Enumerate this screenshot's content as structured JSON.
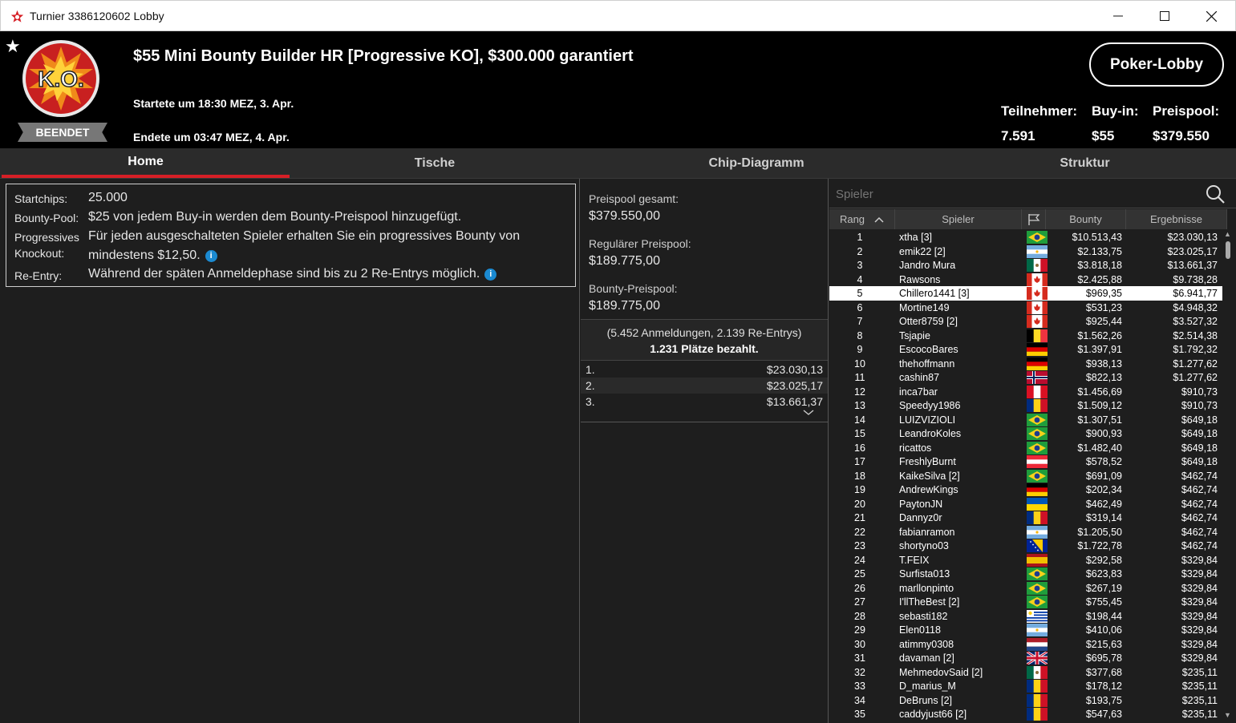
{
  "window": {
    "title": "Turnier 3386120602 Lobby"
  },
  "header": {
    "status": "BEENDET",
    "tournament_name": "$55 Mini Bounty Builder HR [Progressive KO], $300.000 garantiert",
    "started": "Startete um 18:30 MEZ, 3. Apr.",
    "ended": "Endete um 03:47 MEZ, 4. Apr.",
    "lobby_button": "Poker-Lobby",
    "logo_text": "K.O.",
    "stats": {
      "participants_label": "Teilnehmer:",
      "participants": "7.591",
      "buyin_label": "Buy-in:",
      "buyin": "$55",
      "prizepool_label": "Preispool:",
      "prizepool": "$379.550"
    }
  },
  "tabs": [
    "Home",
    "Tische",
    "Chip-Diagramm",
    "Struktur"
  ],
  "info": {
    "startchips_label": "Startchips:",
    "startchips": "25.000",
    "bountypool_label": "Bounty-Pool:",
    "bountypool": "$25 von jedem Buy-in werden dem Bounty-Preispool hinzugefügt.",
    "pko_label_1": "Progressives",
    "pko_label_2": "Knockout:",
    "pko_text_1": "Für jeden ausgeschalteten Spieler erhalten Sie ein progressives Bounty von",
    "pko_text_2": "mindestens $12,50.",
    "reentry_label": "Re-Entry:",
    "reentry": "Während der späten Anmeldephase sind bis zu 2 Re-Entrys möglich."
  },
  "prizepool": {
    "total_label": "Preispool gesamt:",
    "total": "$379.550,00",
    "regular_label": "Regulärer Preispool:",
    "regular": "$189.775,00",
    "bounty_label": "Bounty-Preispool:",
    "bounty": "$189.775,00",
    "registrations": "(5.452 Anmeldungen, 2.139 Re-Entrys)",
    "paid_places": "1.231 Plätze bezahlt.",
    "payouts": [
      {
        "rank": "1.",
        "amount": "$23.030,13"
      },
      {
        "rank": "2.",
        "amount": "$23.025,17"
      },
      {
        "rank": "3.",
        "amount": "$13.661,37"
      }
    ]
  },
  "players": {
    "search_placeholder": "Spieler",
    "columns": {
      "rank": "Rang",
      "player": "Spieler",
      "bounty": "Bounty",
      "result": "Ergebnisse"
    },
    "selected_rank": "5",
    "rows": [
      {
        "rank": "1",
        "name": "xtha [3]",
        "flag": "br",
        "bounty": "$10.513,43",
        "result": "$23.030,13"
      },
      {
        "rank": "2",
        "name": "emik22 [2]",
        "flag": "ar",
        "bounty": "$2.133,75",
        "result": "$23.025,17"
      },
      {
        "rank": "3",
        "name": "Jandro Mura",
        "flag": "mx",
        "bounty": "$3.818,18",
        "result": "$13.661,37"
      },
      {
        "rank": "4",
        "name": "Rawsons",
        "flag": "ca",
        "bounty": "$2.425,88",
        "result": "$9.738,28"
      },
      {
        "rank": "5",
        "name": "Chillero1441 [3]",
        "flag": "ca",
        "bounty": "$969,35",
        "result": "$6.941,77"
      },
      {
        "rank": "6",
        "name": "Mortine149",
        "flag": "ca",
        "bounty": "$531,23",
        "result": "$4.948,32"
      },
      {
        "rank": "7",
        "name": "Otter8759 [2]",
        "flag": "ca",
        "bounty": "$925,44",
        "result": "$3.527,32"
      },
      {
        "rank": "8",
        "name": "Tsjapie",
        "flag": "be",
        "bounty": "$1.562,26",
        "result": "$2.514,38"
      },
      {
        "rank": "9",
        "name": "EscocoBares",
        "flag": "de",
        "bounty": "$1.397,91",
        "result": "$1.792,32"
      },
      {
        "rank": "10",
        "name": "thehoffmann",
        "flag": "de",
        "bounty": "$938,13",
        "result": "$1.277,62"
      },
      {
        "rank": "11",
        "name": "cashin87",
        "flag": "no",
        "bounty": "$822,13",
        "result": "$1.277,62"
      },
      {
        "rank": "12",
        "name": "inca7bar",
        "flag": "pe",
        "bounty": "$1.456,69",
        "result": "$910,73"
      },
      {
        "rank": "13",
        "name": "Speedyy1986",
        "flag": "ro",
        "bounty": "$1.509,12",
        "result": "$910,73"
      },
      {
        "rank": "14",
        "name": "LUIZVIZIOLI",
        "flag": "br",
        "bounty": "$1.307,51",
        "result": "$649,18"
      },
      {
        "rank": "15",
        "name": "LeandroKoles",
        "flag": "br",
        "bounty": "$900,93",
        "result": "$649,18"
      },
      {
        "rank": "16",
        "name": "ricattos",
        "flag": "br",
        "bounty": "$1.482,40",
        "result": "$649,18"
      },
      {
        "rank": "17",
        "name": "FreshlyBurnt",
        "flag": "at",
        "bounty": "$578,52",
        "result": "$649,18"
      },
      {
        "rank": "18",
        "name": "KaikeSilva [2]",
        "flag": "br",
        "bounty": "$691,09",
        "result": "$462,74"
      },
      {
        "rank": "19",
        "name": "AndrewKings",
        "flag": "de",
        "bounty": "$202,34",
        "result": "$462,74"
      },
      {
        "rank": "20",
        "name": "PaytonJN",
        "flag": "ua",
        "bounty": "$462,49",
        "result": "$462,74"
      },
      {
        "rank": "21",
        "name": "Dannyz0r",
        "flag": "ro",
        "bounty": "$319,14",
        "result": "$462,74"
      },
      {
        "rank": "22",
        "name": "fabianramon",
        "flag": "ar",
        "bounty": "$1.205,50",
        "result": "$462,74"
      },
      {
        "rank": "23",
        "name": "shortyno03",
        "flag": "ba",
        "bounty": "$1.722,78",
        "result": "$462,74"
      },
      {
        "rank": "24",
        "name": "T.FEIX",
        "flag": "es",
        "bounty": "$292,58",
        "result": "$329,84"
      },
      {
        "rank": "25",
        "name": "Surfista013",
        "flag": "br",
        "bounty": "$623,83",
        "result": "$329,84"
      },
      {
        "rank": "26",
        "name": "marllonpinto",
        "flag": "br",
        "bounty": "$267,19",
        "result": "$329,84"
      },
      {
        "rank": "27",
        "name": "I'llTheBest [2]",
        "flag": "br",
        "bounty": "$755,45",
        "result": "$329,84"
      },
      {
        "rank": "28",
        "name": "sebasti182",
        "flag": "uy",
        "bounty": "$198,44",
        "result": "$329,84"
      },
      {
        "rank": "29",
        "name": "Elen0118",
        "flag": "ar",
        "bounty": "$410,06",
        "result": "$329,84"
      },
      {
        "rank": "30",
        "name": "atimmy0308",
        "flag": "nl",
        "bounty": "$215,63",
        "result": "$329,84"
      },
      {
        "rank": "31",
        "name": "davaman [2]",
        "flag": "gb",
        "bounty": "$695,78",
        "result": "$329,84"
      },
      {
        "rank": "32",
        "name": "MehmedovSaid [2]",
        "flag": "mx",
        "bounty": "$377,68",
        "result": "$235,11"
      },
      {
        "rank": "33",
        "name": "D_marius_M",
        "flag": "ro",
        "bounty": "$178,12",
        "result": "$235,11"
      },
      {
        "rank": "34",
        "name": "DeBruns [2]",
        "flag": "ro",
        "bounty": "$193,75",
        "result": "$235,11"
      },
      {
        "rank": "35",
        "name": "caddyjust66 [2]",
        "flag": "ro",
        "bounty": "$547,63",
        "result": "$235,11"
      }
    ]
  }
}
